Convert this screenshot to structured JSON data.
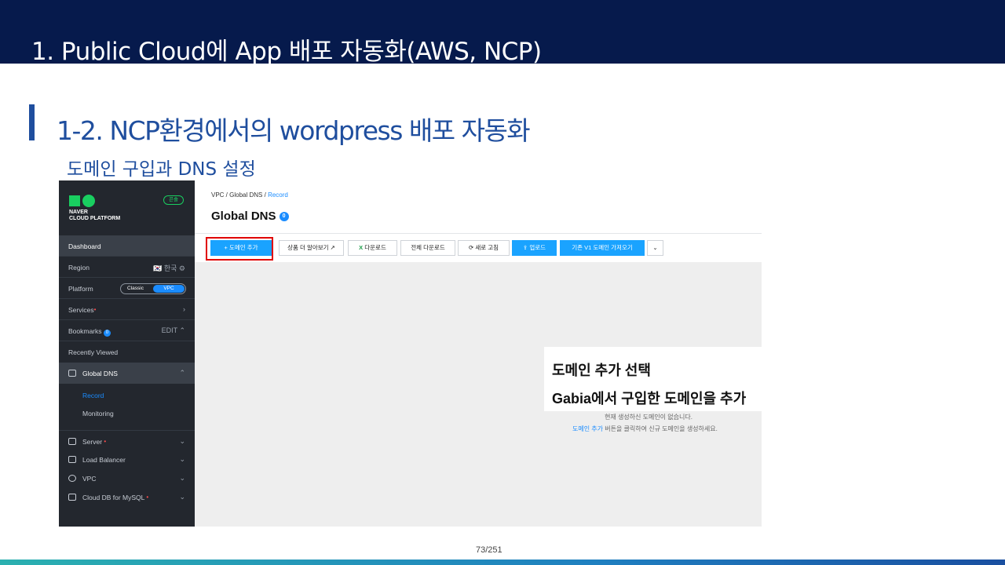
{
  "slide": {
    "title": "1. Public Cloud에 App 배포 자동화(AWS, NCP)",
    "section_title": "1-2. NCP환경에서의 wordpress 배포 자동화",
    "sub_title": "도메인 구입과 DNS 설정",
    "page_number": "73/251",
    "note_line1": "도메인 추가 선택",
    "note_line2": "Gabia에서 구입한 도메인을 추가"
  },
  "sidebar": {
    "logo_line1": "NAVER",
    "logo_line2": "CLOUD PLATFORM",
    "lang_badge": "콘솔",
    "dashboard": "Dashboard",
    "region_label": "Region",
    "region_value": "🇰🇷 한국 ⚙",
    "platform_label": "Platform",
    "platform_classic": "Classic",
    "platform_vpc": "VPC",
    "services": "Services",
    "bookmarks": "Bookmarks",
    "bookmarks_count": "0",
    "edit": "EDIT",
    "recently_viewed": "Recently Viewed",
    "global_dns": "Global DNS",
    "record": "Record",
    "monitoring": "Monitoring",
    "server": "Server",
    "load_balancer": "Load Balancer",
    "vpc": "VPC",
    "cloud_db": "Cloud DB for MySQL"
  },
  "main": {
    "breadcrumb_1": "VPC /",
    "breadcrumb_2": "Global DNS /",
    "breadcrumb_3": "Record",
    "page_title": "Global DNS",
    "count": "0",
    "toolbar": {
      "add_domain": "+ 도메인 추가",
      "learn_more": "상품 더 알아보기 ↗",
      "download": "다운로드",
      "download_all": "전체 다운로드",
      "refresh": "⟳ 새로 고침",
      "upload": "⇪ 업로드",
      "import_v1": "기존 V1 도메인 가져오기",
      "more": "⌄"
    },
    "empty_line1": "현재 생성하신 도메인이 없습니다.",
    "empty_link": "도메인 추가",
    "empty_line2_rest": " 버튼을 클릭하여 신규 도메인을 생성하세요."
  },
  "colors": {
    "header_bg": "#061a4c",
    "accent_blue": "#1f4e9e",
    "ncp_green": "#19ce60",
    "button_blue": "#1aa3ff",
    "highlight_red": "#e00000"
  }
}
